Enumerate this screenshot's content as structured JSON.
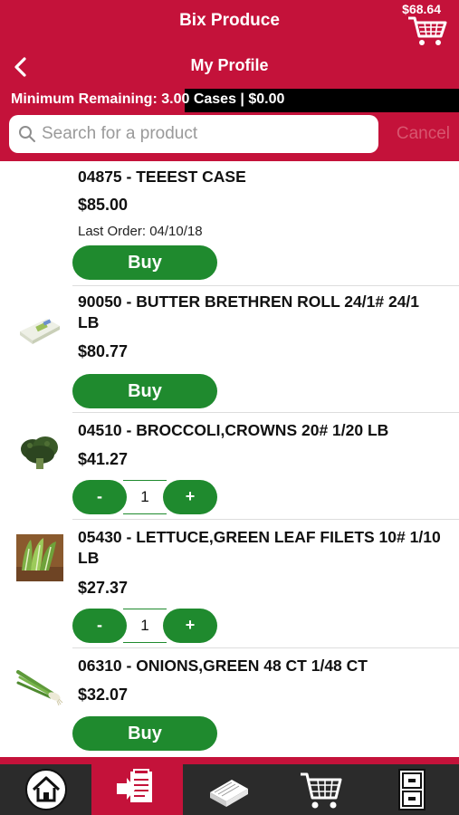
{
  "header": {
    "app_title": "Bix Produce",
    "page_title": "My Profile",
    "cart_total": "$68.64"
  },
  "minimum_bar": {
    "text": "Minimum Remaining: 3.00 Cases | $0.00"
  },
  "search": {
    "placeholder": "Search for a product",
    "cancel_label": "Cancel"
  },
  "products": [
    {
      "name": "04875 - TEEEST CASE",
      "price": "$85.00",
      "last_order": "Last Order: 04/10/18",
      "action": "buy",
      "buy_label": "Buy"
    },
    {
      "name": "90050 - BUTTER BRETHREN ROLL 24/1# 24/1 LB",
      "price": "$80.77",
      "action": "buy",
      "buy_label": "Buy"
    },
    {
      "name": "04510 - BROCCOLI,CROWNS 20# 1/20 LB",
      "price": "$41.27",
      "action": "stepper",
      "minus_label": "-",
      "quantity": "1",
      "plus_label": "+"
    },
    {
      "name": "05430 - LETTUCE,GREEN LEAF FILETS 10# 1/10 LB",
      "price": "$27.37",
      "action": "stepper",
      "minus_label": "-",
      "quantity": "1",
      "plus_label": "+"
    },
    {
      "name": "06310 - ONIONS,GREEN 48 CT 1/48 CT",
      "price": "$32.07",
      "action": "buy",
      "buy_label": "Buy"
    }
  ],
  "bottom_nav": {
    "tabs": [
      {
        "icon": "home-icon",
        "active": false
      },
      {
        "icon": "order-list-icon",
        "active": true
      },
      {
        "icon": "catalog-book-icon",
        "active": false
      },
      {
        "icon": "cart-icon",
        "active": false
      },
      {
        "icon": "filing-cabinet-icon",
        "active": false
      }
    ]
  },
  "colors": {
    "brand_red": "#c4123a",
    "button_green": "#1f8a2e",
    "nav_dark": "#2b2b2b"
  }
}
